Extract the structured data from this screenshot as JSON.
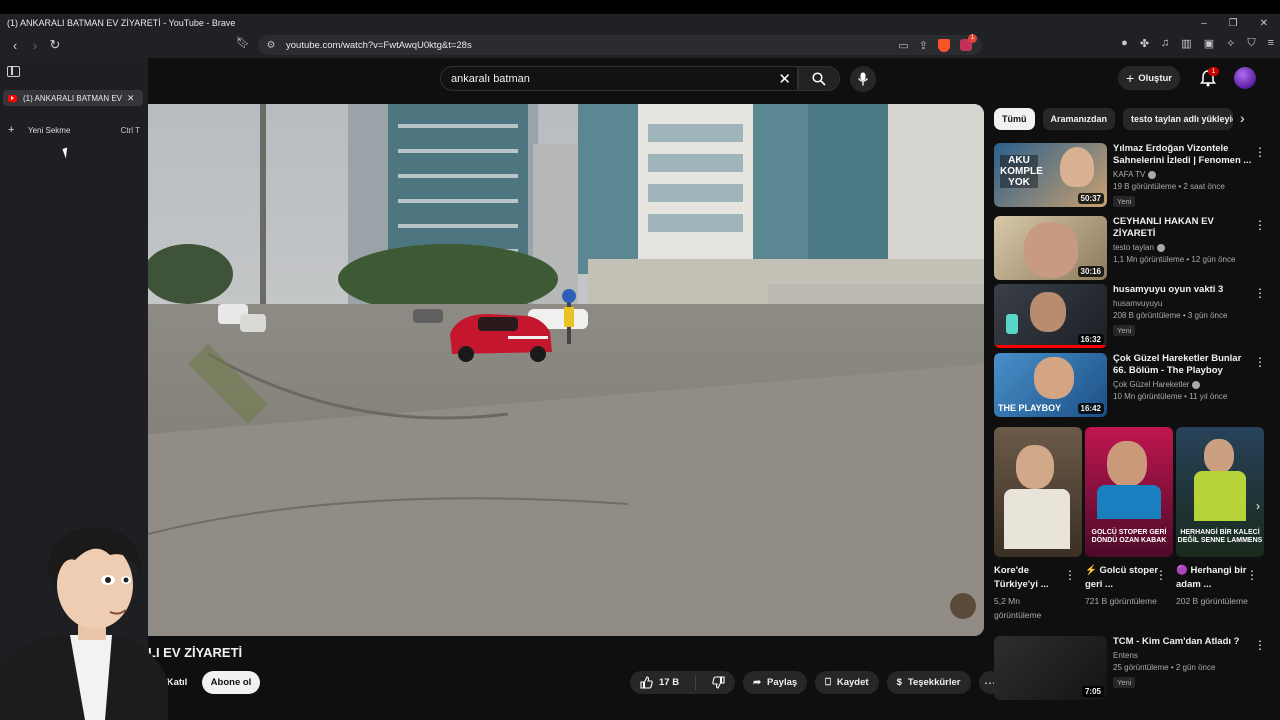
{
  "browser": {
    "window_title": "(1) ANKARALI BATMAN EV ZİYARETİ - YouTube - Brave",
    "url": "youtube.com/watch?v=FwtAwqU0ktg&t=28s",
    "rewards_count": "1",
    "vertical_tabs": {
      "active_tab": "(1) ANKARALI BATMAN EV ZİYARETİ - YouTube",
      "new_tab_label": "Yeni Sekme",
      "new_tab_shortcut": "Ctrl T"
    }
  },
  "youtube": {
    "search_query": "ankaralı batman",
    "create_label": "Oluştur",
    "notification_count": "1",
    "video": {
      "title_visible": "LI EV ZİYARETİ",
      "join_label": "Katıl",
      "subscribe_label": "Abone ol",
      "like_count": "17 B",
      "share_label": "Paylaş",
      "save_label": "Kaydet",
      "thanks_label": "Teşekkürler"
    },
    "chips": [
      {
        "label": "Tümü",
        "active": true
      },
      {
        "label": "Aramanızdan",
        "active": false
      },
      {
        "label": "testo taylan adlı yükleyici",
        "active": false
      }
    ],
    "recommendations": [
      {
        "title": "Yılmaz Erdoğan Vizontele Sahnelerini İzledi | Fenomen ...",
        "channel": "KAFA TV",
        "meta": "19 B görüntüleme • 2 saat önce",
        "badge": "Yeni",
        "duration": "50:37"
      },
      {
        "title": "CEYHANLI HAKAN EV ZİYARETİ",
        "channel": "testo taylan",
        "meta": "1,1 Mn görüntüleme • 12 gün önce",
        "badge": "",
        "duration": "30:16"
      },
      {
        "title": "husamyuyu oyun vakti 3",
        "channel": "husamvuyuyu",
        "meta": "208 B görüntüleme • 3 gün önce",
        "badge": "Yeni",
        "duration": "16:32"
      },
      {
        "title": "Çok Güzel Hareketler Bunlar 66. Bölüm - The Playboy",
        "channel": "Çok Güzel Hareketler",
        "meta": "10 Mn görüntüleme • 11 yıl önce",
        "badge": "",
        "duration": "16:42"
      }
    ],
    "shorts": [
      {
        "title": "Kore'de Türkiye'yi ...",
        "views": "5,2 Mn görüntüleme",
        "overlay": ""
      },
      {
        "title": "⚡ Golcü stoper geri ...",
        "views": "721 B görüntüleme",
        "overlay": "GOLCÜ STOPER GERİ DÖNDÜ OZAN KABAK"
      },
      {
        "title": "🟣 Herhangi bir adam ...",
        "views": "202 B görüntüleme",
        "overlay": "HERHANGİ BİR KALECİ DEĞİL SENNE LAMMENS"
      }
    ],
    "bottom_rec": {
      "title": "TCM - Kim Cam'dan Atladı ?",
      "channel": "Entens",
      "meta": "25 görüntüleme • 2 gün önce",
      "badge": "Yeni",
      "duration": "7:05"
    },
    "thumb_text": {
      "rec1": "AKU KOMPLE YOK",
      "rec4": "THE PLAYBOY"
    }
  },
  "colors": {
    "accent": "#ff0000",
    "background": "#0f0f0f",
    "chip": "#272727"
  }
}
